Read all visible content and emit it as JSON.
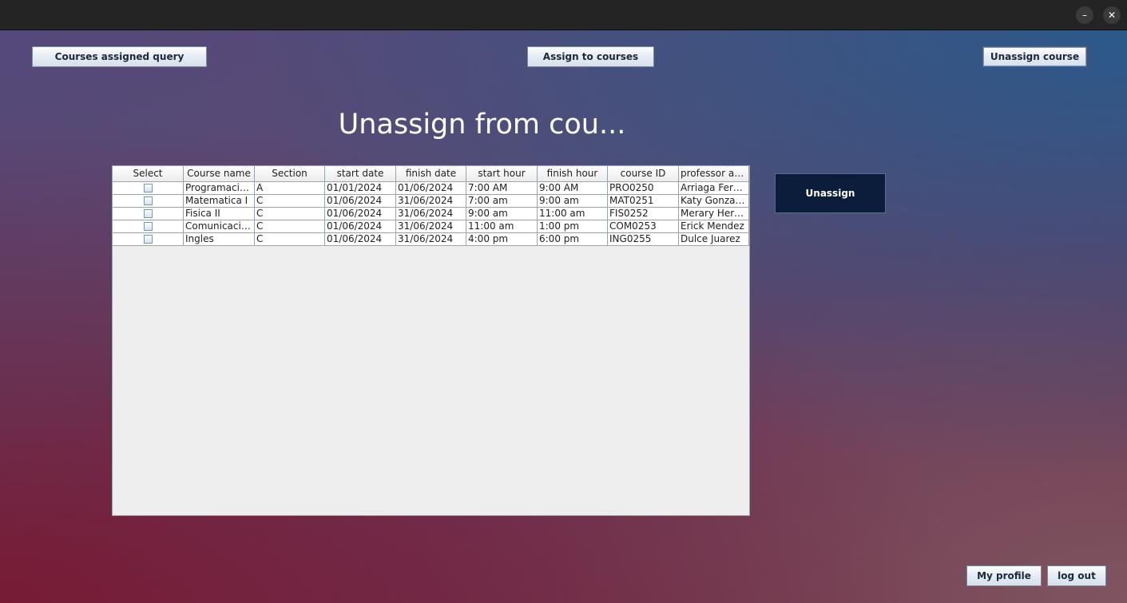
{
  "window": {
    "minimize_glyph": "–",
    "close_glyph": "✕"
  },
  "nav": {
    "courses_assigned_query": "Courses assigned query",
    "assign_to_courses": "Assign to courses",
    "unassign_course": "Unassign course"
  },
  "main": {
    "title": "Unassign from cou..."
  },
  "table": {
    "columns": [
      "Select",
      "Course name",
      "Section",
      "start date",
      "finish date",
      "start hour",
      "finish hour",
      "course ID",
      "professor ass..."
    ],
    "rows": [
      {
        "selected": false,
        "course_name": "Programacio...",
        "section": "A",
        "start_date": "01/01/2024",
        "finish_date": "01/06/2024",
        "start_hour": "7:00 AM",
        "finish_hour": "9:00 AM",
        "course_id": "PRO0250",
        "professor": "Arriaga Fern..."
      },
      {
        "selected": false,
        "course_name": "Matematica I",
        "section": "C",
        "start_date": "01/06/2024",
        "finish_date": "31/06/2024",
        "start_hour": "7:00 am",
        "finish_hour": "9:00 am",
        "course_id": "MAT0251",
        "professor": "Katy Gonzales"
      },
      {
        "selected": false,
        "course_name": "Fisica II",
        "section": "C",
        "start_date": "01/06/2024",
        "finish_date": "31/06/2024",
        "start_hour": "9:00 am",
        "finish_hour": "11:00 am",
        "course_id": "FIS0252",
        "professor": "Merary Hern..."
      },
      {
        "selected": false,
        "course_name": "Comunicacio...",
        "section": "C",
        "start_date": "01/06/2024",
        "finish_date": "31/06/2024",
        "start_hour": "11:00 am",
        "finish_hour": "1:00 pm",
        "course_id": "COM0253",
        "professor": "Erick Mendez"
      },
      {
        "selected": false,
        "course_name": "Ingles",
        "section": "C",
        "start_date": "01/06/2024",
        "finish_date": "31/06/2024",
        "start_hour": "4:00 pm",
        "finish_hour": "6:00 pm",
        "course_id": "ING0255",
        "professor": "Dulce Juarez"
      }
    ]
  },
  "actions": {
    "unassign": "Unassign"
  },
  "footer": {
    "my_profile": "My profile",
    "log_out": "log out"
  }
}
